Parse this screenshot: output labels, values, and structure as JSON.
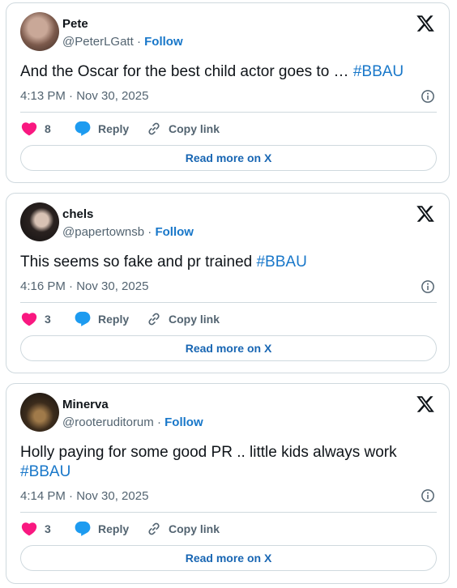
{
  "colors": {
    "heart": "#f91880",
    "reply": "#1d9bf0",
    "link": "#1877c9",
    "border": "#cfd9de",
    "muted": "#536471"
  },
  "tweets": [
    {
      "name": "Pete",
      "handle": "@PeterLGatt",
      "separator": "·",
      "follow": "Follow",
      "text": "And the Oscar for the best child actor goes to … ",
      "hashtag": "#BBAU",
      "timestamp": "4:13 PM · Nov 30, 2025",
      "likes": "8",
      "reply": "Reply",
      "copy_link": "Copy link",
      "read_more": "Read more on X"
    },
    {
      "name": "chels",
      "handle": "@papertownsb",
      "separator": "·",
      "follow": "Follow",
      "text": "This seems so fake and pr trained ",
      "hashtag": "#BBAU",
      "timestamp": "4:16 PM · Nov 30, 2025",
      "likes": "3",
      "reply": "Reply",
      "copy_link": "Copy link",
      "read_more": "Read more on X"
    },
    {
      "name": "Minerva",
      "handle": "@rooteruditorum",
      "separator": "·",
      "follow": "Follow",
      "text": "Holly paying for some good PR .. little kids always work ",
      "hashtag": "#BBAU",
      "timestamp": "4:14 PM · Nov 30, 2025",
      "likes": "3",
      "reply": "Reply",
      "copy_link": "Copy link",
      "read_more": "Read more on X"
    }
  ]
}
